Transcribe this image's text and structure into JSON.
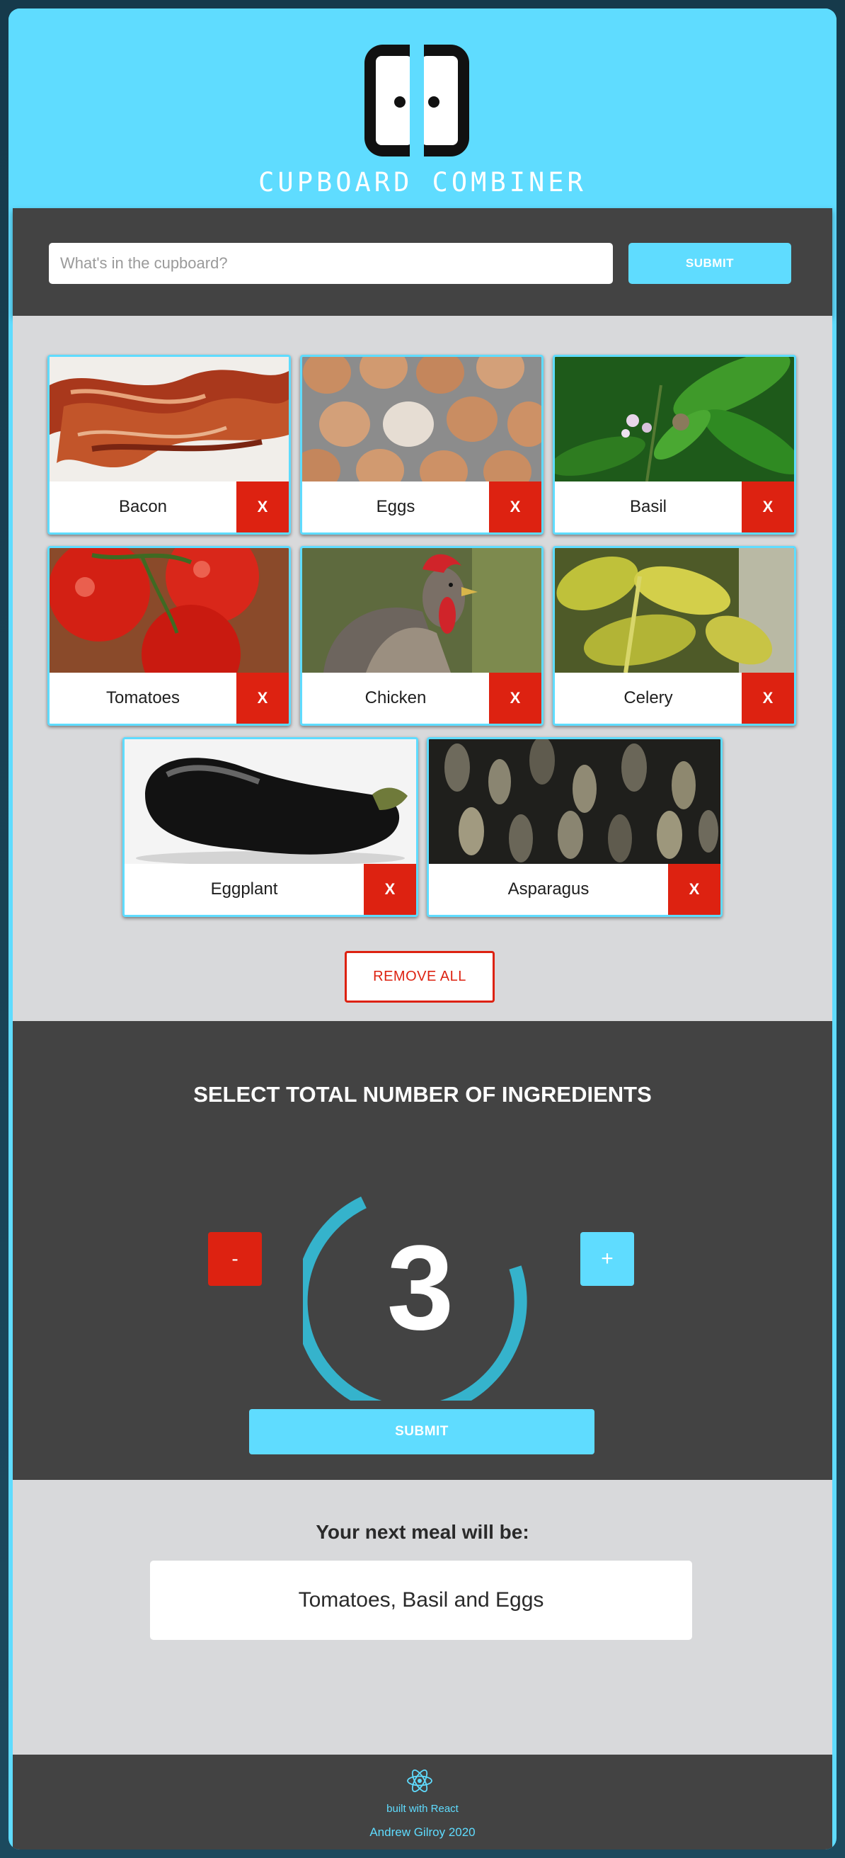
{
  "header": {
    "logo_text": "CUPBOARD COMBINER"
  },
  "search": {
    "placeholder": "What's in the cupboard?",
    "value": "",
    "submit_label": "SUBMIT"
  },
  "ingredients": [
    {
      "label": "Bacon",
      "remove_label": "X",
      "image": "bacon-photo"
    },
    {
      "label": "Eggs",
      "remove_label": "X",
      "image": "eggs-photo"
    },
    {
      "label": "Basil",
      "remove_label": "X",
      "image": "basil-photo"
    },
    {
      "label": "Tomatoes",
      "remove_label": "X",
      "image": "tomatoes-photo"
    },
    {
      "label": "Chicken",
      "remove_label": "X",
      "image": "chicken-photo"
    },
    {
      "label": "Celery",
      "remove_label": "X",
      "image": "celery-photo"
    },
    {
      "label": "Eggplant",
      "remove_label": "X",
      "image": "eggplant-photo"
    },
    {
      "label": "Asparagus",
      "remove_label": "X",
      "image": "asparagus-photo"
    }
  ],
  "remove_all_label": "REMOVE ALL",
  "selector": {
    "title": "SELECT TOTAL NUMBER OF INGREDIENTS",
    "minus_label": "-",
    "plus_label": "+",
    "count": "3",
    "submit_label": "SUBMIT"
  },
  "result": {
    "heading": "Your next meal will be:",
    "meal": "Tomatoes, Basil and Eggs"
  },
  "footer": {
    "built_with": "built with React",
    "copyright": "Andrew Gilroy 2020"
  },
  "colors": {
    "accent": "#5fdcff",
    "danger": "#dd2211",
    "dark_band": "#434343",
    "light_band": "#d8d9db",
    "dial_ring": "#35b3cc"
  }
}
